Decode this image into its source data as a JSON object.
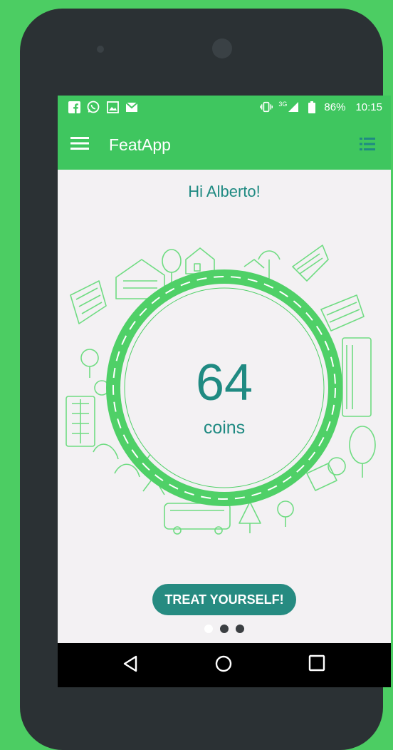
{
  "status_bar": {
    "notification_icons": [
      "facebook-icon",
      "whatsapp-icon",
      "gallery-icon",
      "gmail-icon"
    ],
    "network": "3G",
    "battery_percent": "86%",
    "time": "10:15"
  },
  "toolbar": {
    "title": "FeatApp",
    "menu_icon": "hamburger-menu-icon",
    "action_icon": "list-icon"
  },
  "greeting": "Hi Alberto!",
  "coins": {
    "value": "64",
    "label": "coins"
  },
  "treat_button": {
    "label": "TREAT YOURSELF!"
  },
  "pager": {
    "total": 3,
    "active_index": 0
  },
  "nav_bar": [
    "back-icon",
    "home-icon",
    "recents-icon"
  ],
  "colors": {
    "background": "#4ccd63",
    "app_bar": "#3fc65f",
    "accent_teal": "#1f8a82",
    "button": "#268b81",
    "ring": "#4fd067",
    "screen_bg": "#f3f1f3"
  }
}
